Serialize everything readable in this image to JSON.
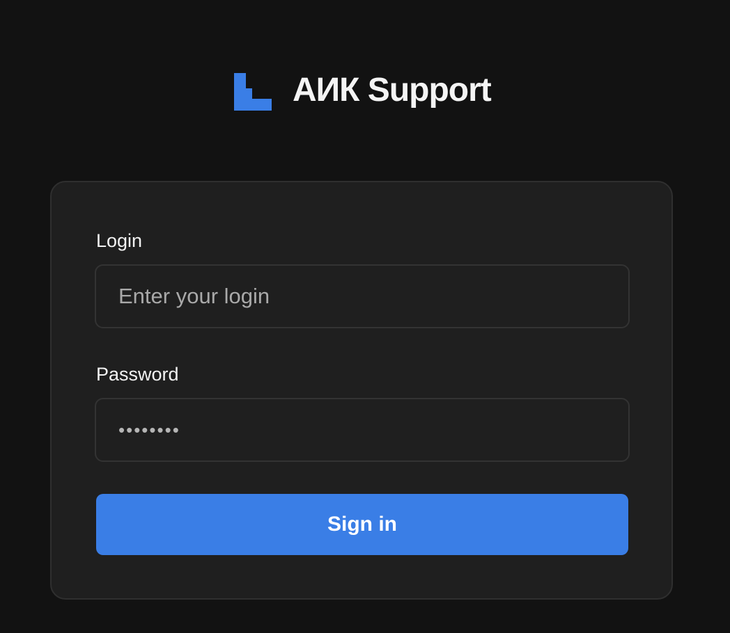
{
  "brand": {
    "name": "АИК Support",
    "logo_icon": "brand-logo-icon",
    "logo_color": "#3a7ee6"
  },
  "form": {
    "login_label": "Login",
    "login_placeholder": "Enter your login",
    "login_value": "",
    "password_label": "Password",
    "password_value": "••••••••",
    "submit_label": "Sign in"
  },
  "colors": {
    "background": "#121212",
    "card": "#1f1f1f",
    "accent": "#3a7ee6"
  }
}
